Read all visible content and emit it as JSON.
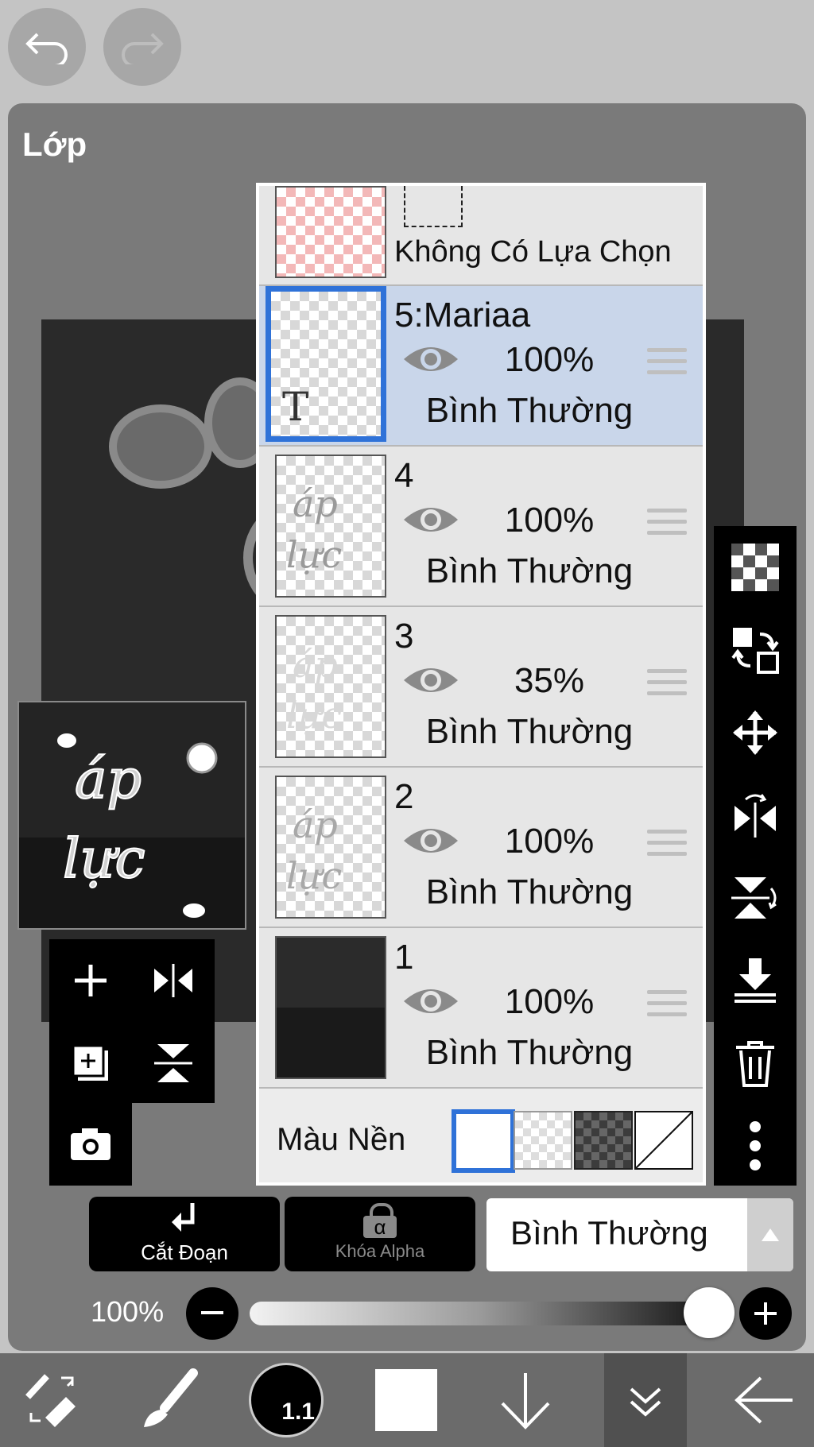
{
  "panel": {
    "title": "Lớp"
  },
  "layers": {
    "selection_row": {
      "label": "Không Có Lựa Chọn"
    },
    "rows": [
      {
        "name": "5:Mariaa",
        "opacity": "100%",
        "blend": "Bình Thường",
        "type_badge": "T",
        "selected": true
      },
      {
        "name": "4",
        "opacity": "100%",
        "blend": "Bình Thường",
        "selected": false
      },
      {
        "name": "3",
        "opacity": "35%",
        "blend": "Bình Thường",
        "selected": false
      },
      {
        "name": "2",
        "opacity": "100%",
        "blend": "Bình Thường",
        "selected": false
      },
      {
        "name": "1",
        "opacity": "100%",
        "blend": "Bình Thường",
        "selected": false
      }
    ],
    "background": {
      "label": "Màu Nền",
      "options": [
        "white",
        "transparent-light",
        "transparent-dark",
        "none"
      ],
      "selected": "white"
    }
  },
  "bottom_buttons": {
    "clip_label": "Cắt Đoạn",
    "alpha_lock_label": "Khóa Alpha",
    "alpha_symbol": "α"
  },
  "blend_select": {
    "value": "Bình Thường"
  },
  "opacity": {
    "value_label": "100%",
    "value": 1.0
  },
  "brush": {
    "size_label": "1.1"
  },
  "colors": {
    "accent": "#2f72d8",
    "selected_row": "#c9d6ea",
    "panel": "#7a7a7a"
  }
}
